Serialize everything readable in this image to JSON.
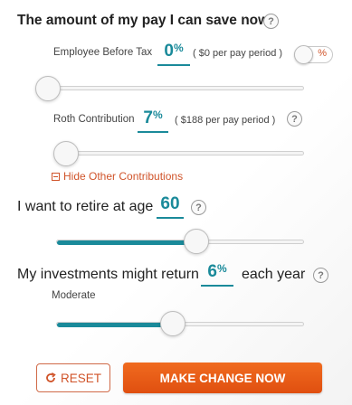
{
  "savings": {
    "heading": "The amount of my pay I can save now",
    "help": "?",
    "employee_before_tax": {
      "label": "Employee Before Tax",
      "percent": "0",
      "percent_sign": "%",
      "detail": "( $0 per pay period )",
      "toggle_label": "%",
      "slider_fraction": 0.0
    },
    "roth": {
      "label": "Roth Contribution",
      "percent": "7",
      "percent_sign": "%",
      "detail": "( $188 per pay period )",
      "help": "?",
      "slider_fraction": 0.04
    },
    "hide_link": "Hide Other Contributions"
  },
  "retire": {
    "label": "I want to retire at age",
    "age": "60",
    "help": "?",
    "slider_fraction": 0.56
  },
  "investments": {
    "label_before": "My investments might return",
    "percent": "6",
    "percent_sign": "%",
    "label_after": "each year",
    "help": "?",
    "risk_label": "Moderate",
    "slider_fraction": 0.47
  },
  "buttons": {
    "reset": "RESET",
    "reset_icon": "refresh-icon",
    "make_change": "MAKE CHANGE NOW"
  },
  "colors": {
    "accent": "#1a8a9a",
    "orange": "#e8591a"
  }
}
